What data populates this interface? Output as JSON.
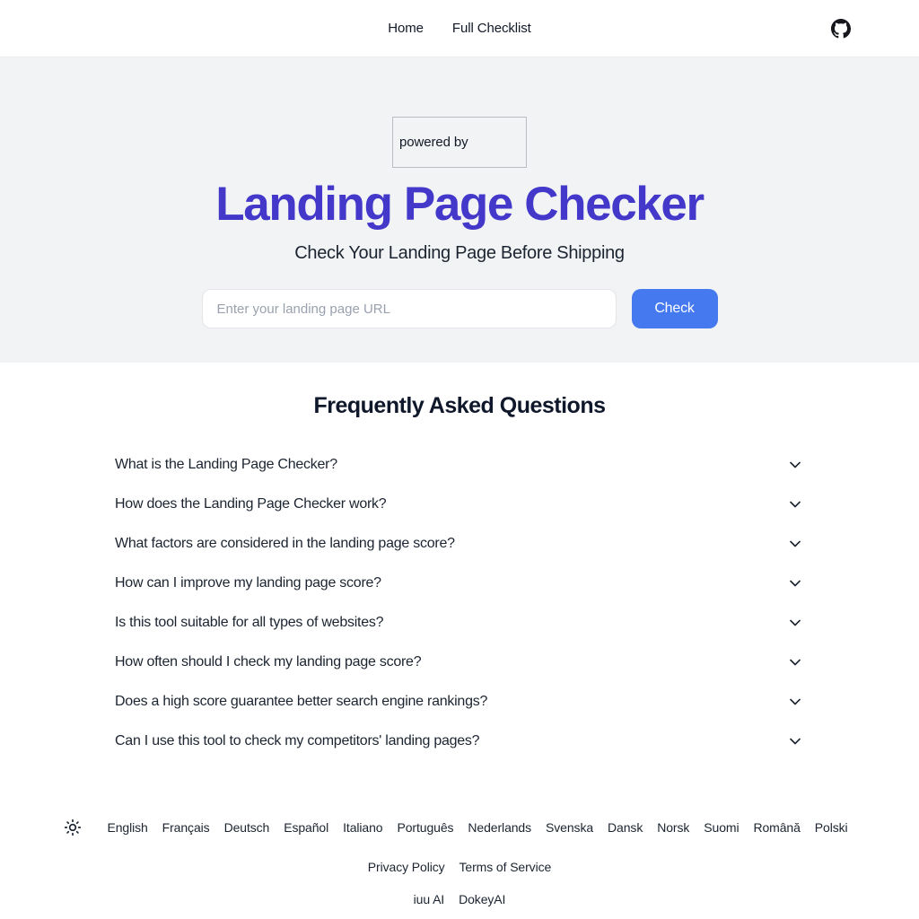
{
  "header": {
    "nav_items": [
      {
        "label": "Home"
      },
      {
        "label": "Full Checklist"
      }
    ],
    "github_icon": "github-icon"
  },
  "hero": {
    "powered_by_label": "powered by",
    "title": "Landing Page Checker",
    "subtitle": "Check Your Landing Page Before Shipping",
    "input_placeholder": "Enter your landing page URL",
    "input_value": "",
    "check_button_label": "Check",
    "title_color": "#4338ca",
    "button_color": "#4579f0",
    "background_color": "#f2f3f5"
  },
  "faq": {
    "heading": "Frequently Asked Questions",
    "chevron_icon": "chevron-down-icon",
    "items": [
      {
        "question": "What is the Landing Page Checker?"
      },
      {
        "question": "How does the Landing Page Checker work?"
      },
      {
        "question": "What factors are considered in the landing page score?"
      },
      {
        "question": "How can I improve my landing page score?"
      },
      {
        "question": "Is this tool suitable for all types of websites?"
      },
      {
        "question": "How often should I check my landing page score?"
      },
      {
        "question": "Does a high score guarantee better search engine rankings?"
      },
      {
        "question": "Can I use this tool to check my competitors' landing pages?"
      }
    ]
  },
  "footer": {
    "theme_toggle_icon": "sun-icon",
    "languages": [
      {
        "label": "English"
      },
      {
        "label": "Français"
      },
      {
        "label": "Deutsch"
      },
      {
        "label": "Español"
      },
      {
        "label": "Italiano"
      },
      {
        "label": "Português"
      },
      {
        "label": "Nederlands"
      },
      {
        "label": "Svenska"
      },
      {
        "label": "Dansk"
      },
      {
        "label": "Norsk"
      },
      {
        "label": "Suomi"
      },
      {
        "label": "Română"
      },
      {
        "label": "Polski"
      }
    ],
    "legal_links": [
      {
        "label": "Privacy Policy"
      },
      {
        "label": "Terms of Service"
      }
    ],
    "brand_links": [
      {
        "label": "iuu AI"
      },
      {
        "label": "DokeyAI"
      }
    ]
  }
}
